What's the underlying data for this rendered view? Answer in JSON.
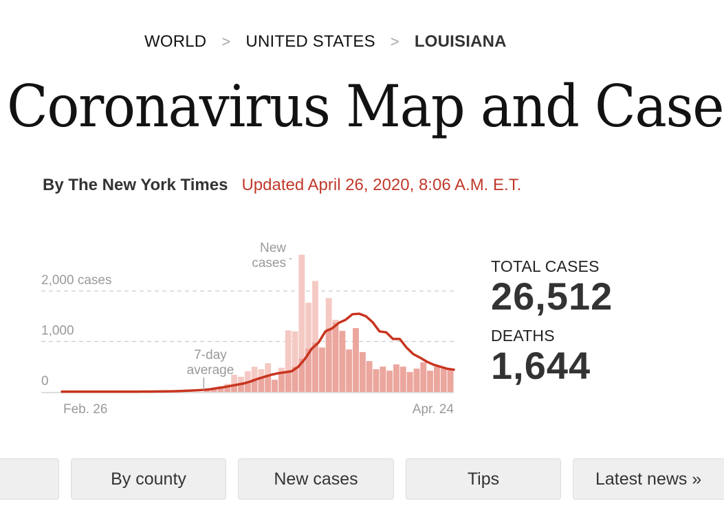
{
  "breadcrumb": {
    "items": [
      "WORLD",
      "UNITED STATES",
      "LOUISIANA"
    ],
    "separator": ">"
  },
  "page_title": "Coronavirus Map and Case",
  "byline": {
    "author": "By The New York Times",
    "updated": "Updated April 26, 2020, 8:06 A.M. E.T."
  },
  "colors": {
    "bar_light": "#f5c9c3",
    "bar_dark": "#eba69e",
    "line": "#c8341f",
    "updated_text": "#c0392b",
    "grid": "#cccccc",
    "axis_text": "#999999"
  },
  "stats": {
    "total_cases_label": "TOTAL CASES",
    "total_cases_value": "26,512",
    "deaths_label": "DEATHS",
    "deaths_value": "1,644"
  },
  "nav": {
    "buttons": [
      "",
      "By county",
      "New cases",
      "Tips",
      "Latest news »"
    ]
  },
  "chart_data": {
    "type": "bar",
    "title": "",
    "xlabel": "",
    "ylabel": "cases",
    "ylim": [
      0,
      2000
    ],
    "grid": true,
    "y_ticks": [
      {
        "value": 0,
        "label": "0"
      },
      {
        "value": 1000,
        "label": "1,000"
      },
      {
        "value": 2000,
        "label": "2,000 cases"
      }
    ],
    "x_tick_labels": [
      {
        "day_index": 0,
        "label": "Feb. 26"
      },
      {
        "day_index": 58,
        "label": "Apr. 24"
      }
    ],
    "annotations": [
      {
        "text": [
          "New",
          "cases"
        ],
        "target": "new-cases-bar",
        "day_index": 35
      },
      {
        "text": [
          "7-day",
          "average"
        ],
        "target": "average-line",
        "day_index": 21
      }
    ],
    "series": [
      {
        "name": "New cases",
        "kind": "bar",
        "start_day_index": 22,
        "values": [
          40,
          70,
          110,
          160,
          340,
          300,
          410,
          500,
          450,
          570,
          240,
          480,
          1220,
          1200,
          2720,
          1770,
          2200,
          880,
          1860,
          1430,
          1210,
          840,
          1265,
          790,
          610,
          450,
          500,
          420,
          545,
          500,
          395,
          460,
          585,
          420,
          500,
          490,
          435
        ]
      },
      {
        "name": "7-day average",
        "kind": "line",
        "start_day_index": 0,
        "values": [
          5,
          5,
          5,
          5,
          5,
          5,
          5,
          5,
          5,
          5,
          5,
          5,
          6,
          7,
          8,
          10,
          12,
          15,
          20,
          25,
          32,
          40,
          55,
          75,
          95,
          120,
          145,
          170,
          210,
          260,
          300,
          340,
          370,
          390,
          410,
          500,
          660,
          860,
          980,
          1200,
          1260,
          1370,
          1430,
          1540,
          1550,
          1500,
          1380,
          1200,
          1180,
          1050,
          1050,
          880,
          750,
          680,
          600,
          540,
          500,
          460,
          440
        ]
      }
    ]
  }
}
